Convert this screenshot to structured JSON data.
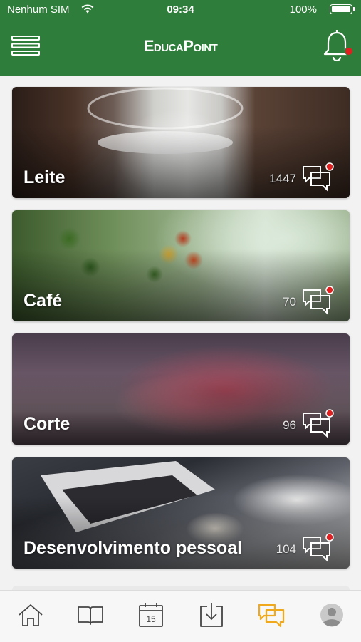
{
  "status_bar": {
    "carrier": "Nenhum SIM",
    "time": "09:34",
    "battery": "100%"
  },
  "header": {
    "logo": "EducaPoint",
    "notification_badge": true
  },
  "cards": [
    {
      "title": "Leite",
      "count": "1447",
      "theme": "milk"
    },
    {
      "title": "Café",
      "count": "70",
      "theme": "coffee"
    },
    {
      "title": "Corte",
      "count": "96",
      "theme": "beef"
    },
    {
      "title": "Desenvolvimento pessoal",
      "count": "104",
      "theme": "laptop"
    }
  ],
  "tab_bar": {
    "tabs": [
      {
        "name": "home",
        "icon": "home-icon"
      },
      {
        "name": "library",
        "icon": "book-icon"
      },
      {
        "name": "calendar",
        "icon": "calendar-icon",
        "label": "15"
      },
      {
        "name": "downloads",
        "icon": "download-icon"
      },
      {
        "name": "forum",
        "icon": "chat-icon",
        "active": true
      },
      {
        "name": "profile",
        "icon": "user-icon"
      }
    ],
    "active_color": "#f0a81c",
    "inactive_color": "#444444"
  },
  "colors": {
    "brand_green": "#2f7d3a",
    "badge_red": "#e02020"
  }
}
